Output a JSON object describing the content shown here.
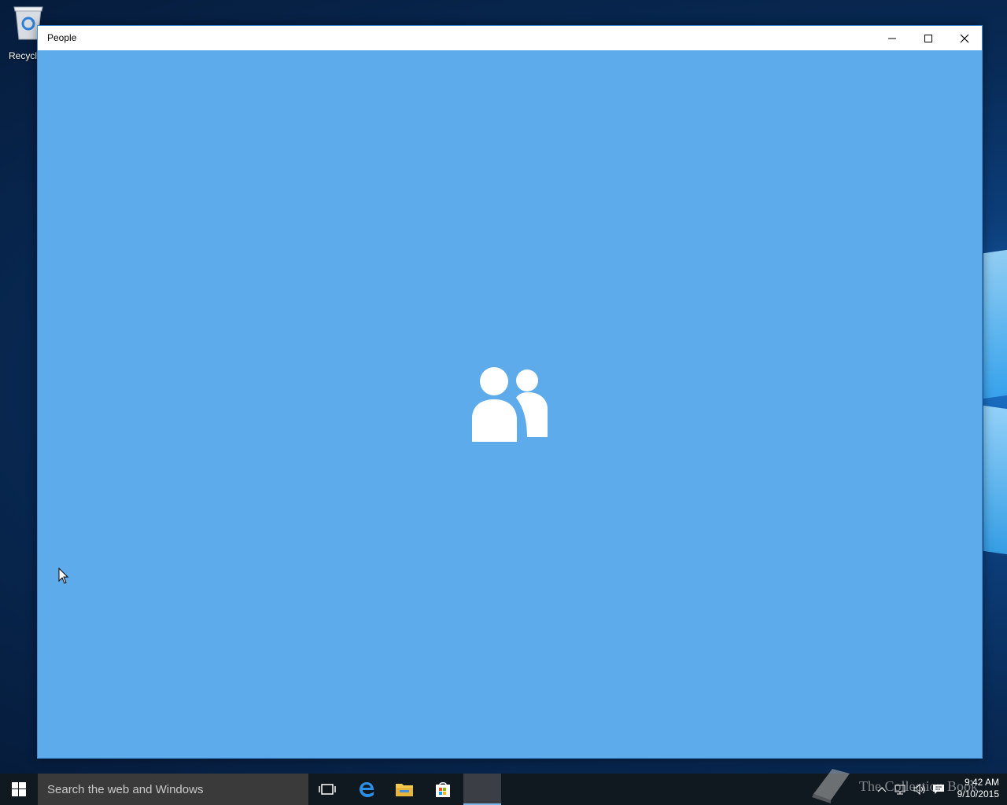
{
  "desktop": {
    "icons": [
      {
        "label": "Recycle",
        "icon": "recycle-bin-icon"
      }
    ]
  },
  "window": {
    "title": "People",
    "controls": {
      "minimize": "minimize-icon",
      "maximize": "maximize-icon",
      "close": "close-icon"
    },
    "background_color": "#5eabeb",
    "splash_icon": "people-icon"
  },
  "taskbar": {
    "search_placeholder": "Search the web and Windows",
    "pinned": [
      {
        "name": "task-view",
        "icon": "task-view-icon"
      },
      {
        "name": "edge",
        "icon": "edge-icon"
      },
      {
        "name": "file-explorer",
        "icon": "folder-icon"
      },
      {
        "name": "store",
        "icon": "store-icon"
      },
      {
        "name": "people",
        "icon": "people-icon",
        "active": true
      }
    ],
    "tray": {
      "time": "9:42 AM",
      "date": "9/10/2015"
    }
  },
  "watermark": {
    "text": "The Collection Book"
  }
}
